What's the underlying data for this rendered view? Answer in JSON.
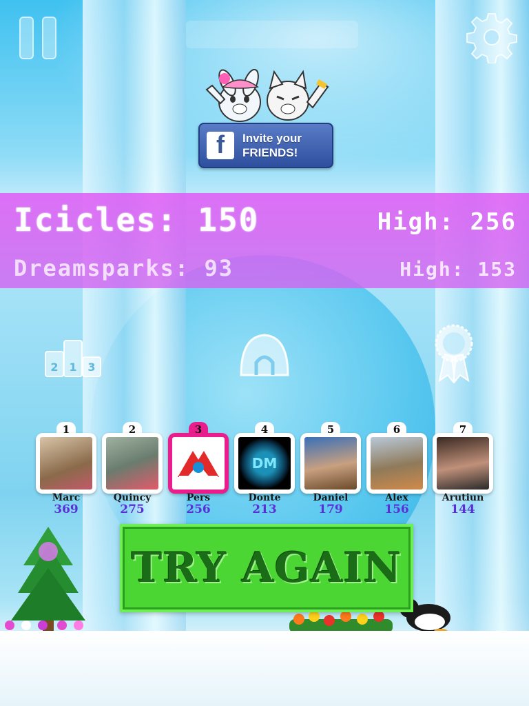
{
  "facebook_invite": {
    "logo": "f",
    "line1": "Invite your",
    "line2": "FRIENDS!"
  },
  "scores": {
    "icicles_label": "Icicles:",
    "icicles_value": "150",
    "icicles_high_label": "High:",
    "icicles_high_value": "256",
    "dreamsparks_label": "Dreamsparks:",
    "dreamsparks_value": "93",
    "dreamsparks_high_label": "High:",
    "dreamsparks_high_value": "153"
  },
  "menu_icons": {
    "podium": {
      "icon": "podium-icon",
      "digits": [
        "2",
        "1",
        "3"
      ]
    },
    "igloo": {
      "icon": "igloo-icon"
    },
    "ribbon": {
      "icon": "ribbon-icon"
    }
  },
  "leaderboard": [
    {
      "rank": "1",
      "name": "Marc",
      "score": "369",
      "photo": "family-photo"
    },
    {
      "rank": "2",
      "name": "Quincy",
      "score": "275",
      "photo": "couple-photo"
    },
    {
      "rank": "3",
      "name": "Pers",
      "score": "256",
      "photo": "logo-avatar",
      "highlight": true
    },
    {
      "rank": "4",
      "name": "Donte",
      "score": "213",
      "photo": "dm-logo-avatar",
      "logo_text": "DM"
    },
    {
      "rank": "5",
      "name": "Daniel",
      "score": "179",
      "photo": "portrait-photo"
    },
    {
      "rank": "6",
      "name": "Alex",
      "score": "156",
      "photo": "outdoor-photo"
    },
    {
      "rank": "7",
      "name": "Arutiun",
      "score": "144",
      "photo": "portrait-glasses-photo"
    }
  ],
  "try_again": {
    "label": "TRY AGAIN"
  },
  "colors": {
    "score_band": "#d95ef2",
    "button_green": "#4bd634",
    "button_text": "#1a6c17",
    "score_text": "#5b2fd6",
    "highlight": "#e91e8c",
    "facebook_blue": "#3b5998"
  }
}
